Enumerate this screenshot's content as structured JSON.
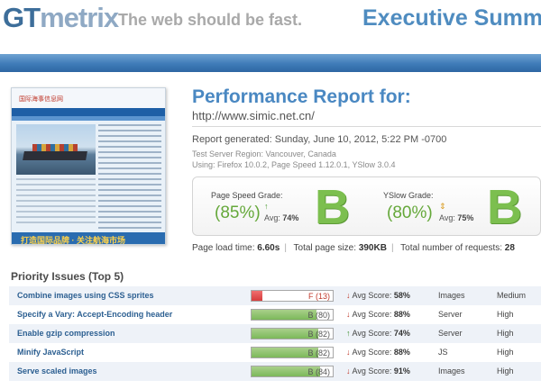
{
  "header": {
    "logo_gt": "GT",
    "logo_metrix": "metrix",
    "tagline": "The web should be fast.",
    "section_title": "Executive Summa"
  },
  "thumbnail": {
    "site_name": "国际海事信息网",
    "banner_text": "打造国际品牌 · 关注航海市场"
  },
  "report": {
    "title": "Performance Report for:",
    "url": "http://www.simic.net.cn/",
    "generated": "Report generated: Sunday, June 10, 2012, 5:22 PM -0700",
    "server_region": "Test Server Region: Vancouver, Canada",
    "using": "Using: Firefox 10.0.2, Page Speed 1.12.0.1, YSlow 3.0.4"
  },
  "grades": {
    "pagespeed": {
      "label": "Page Speed Grade:",
      "percent": "(85%)",
      "avg_label": "Avg:",
      "avg_value": "74%",
      "letter": "B",
      "trend_icon": "arrow-up"
    },
    "yslow": {
      "label": "YSlow Grade:",
      "percent": "(80%)",
      "avg_label": "Avg:",
      "avg_value": "75%",
      "letter": "B",
      "trend_icon": "arrow-updown"
    }
  },
  "stats": {
    "load_label": "Page load time:",
    "load_value": "6.60s",
    "size_label": "Total page size:",
    "size_value": "390KB",
    "requests_label": "Total number of requests:",
    "requests_value": "28"
  },
  "priority": {
    "title": "Priority Issues (Top 5)",
    "avg_label": "Avg Score:",
    "rows": [
      {
        "name": "Combine images using CSS sprites",
        "grade": "F (13)",
        "score": 0.13,
        "bar_color": "red",
        "trend": "down",
        "avg": "58%",
        "type": "Images",
        "priority": "Medium"
      },
      {
        "name": "Specify a Vary: Accept-Encoding header",
        "grade": "B (80)",
        "score": 0.8,
        "bar_color": "green",
        "trend": "down",
        "avg": "88%",
        "type": "Server",
        "priority": "High"
      },
      {
        "name": "Enable gzip compression",
        "grade": "B (82)",
        "score": 0.82,
        "bar_color": "green",
        "trend": "up",
        "avg": "74%",
        "type": "Server",
        "priority": "High"
      },
      {
        "name": "Minify JavaScript",
        "grade": "B (82)",
        "score": 0.82,
        "bar_color": "green",
        "trend": "down",
        "avg": "88%",
        "type": "JS",
        "priority": "High"
      },
      {
        "name": "Serve scaled images",
        "grade": "B (84)",
        "score": 0.84,
        "bar_color": "green",
        "trend": "down",
        "avg": "91%",
        "type": "Images",
        "priority": "High"
      }
    ]
  },
  "colors": {
    "brand_blue": "#4a88c2",
    "grade_green": "#7cbf4f",
    "grade_red": "#d63d3d",
    "header_band": "#3f7bb8"
  }
}
